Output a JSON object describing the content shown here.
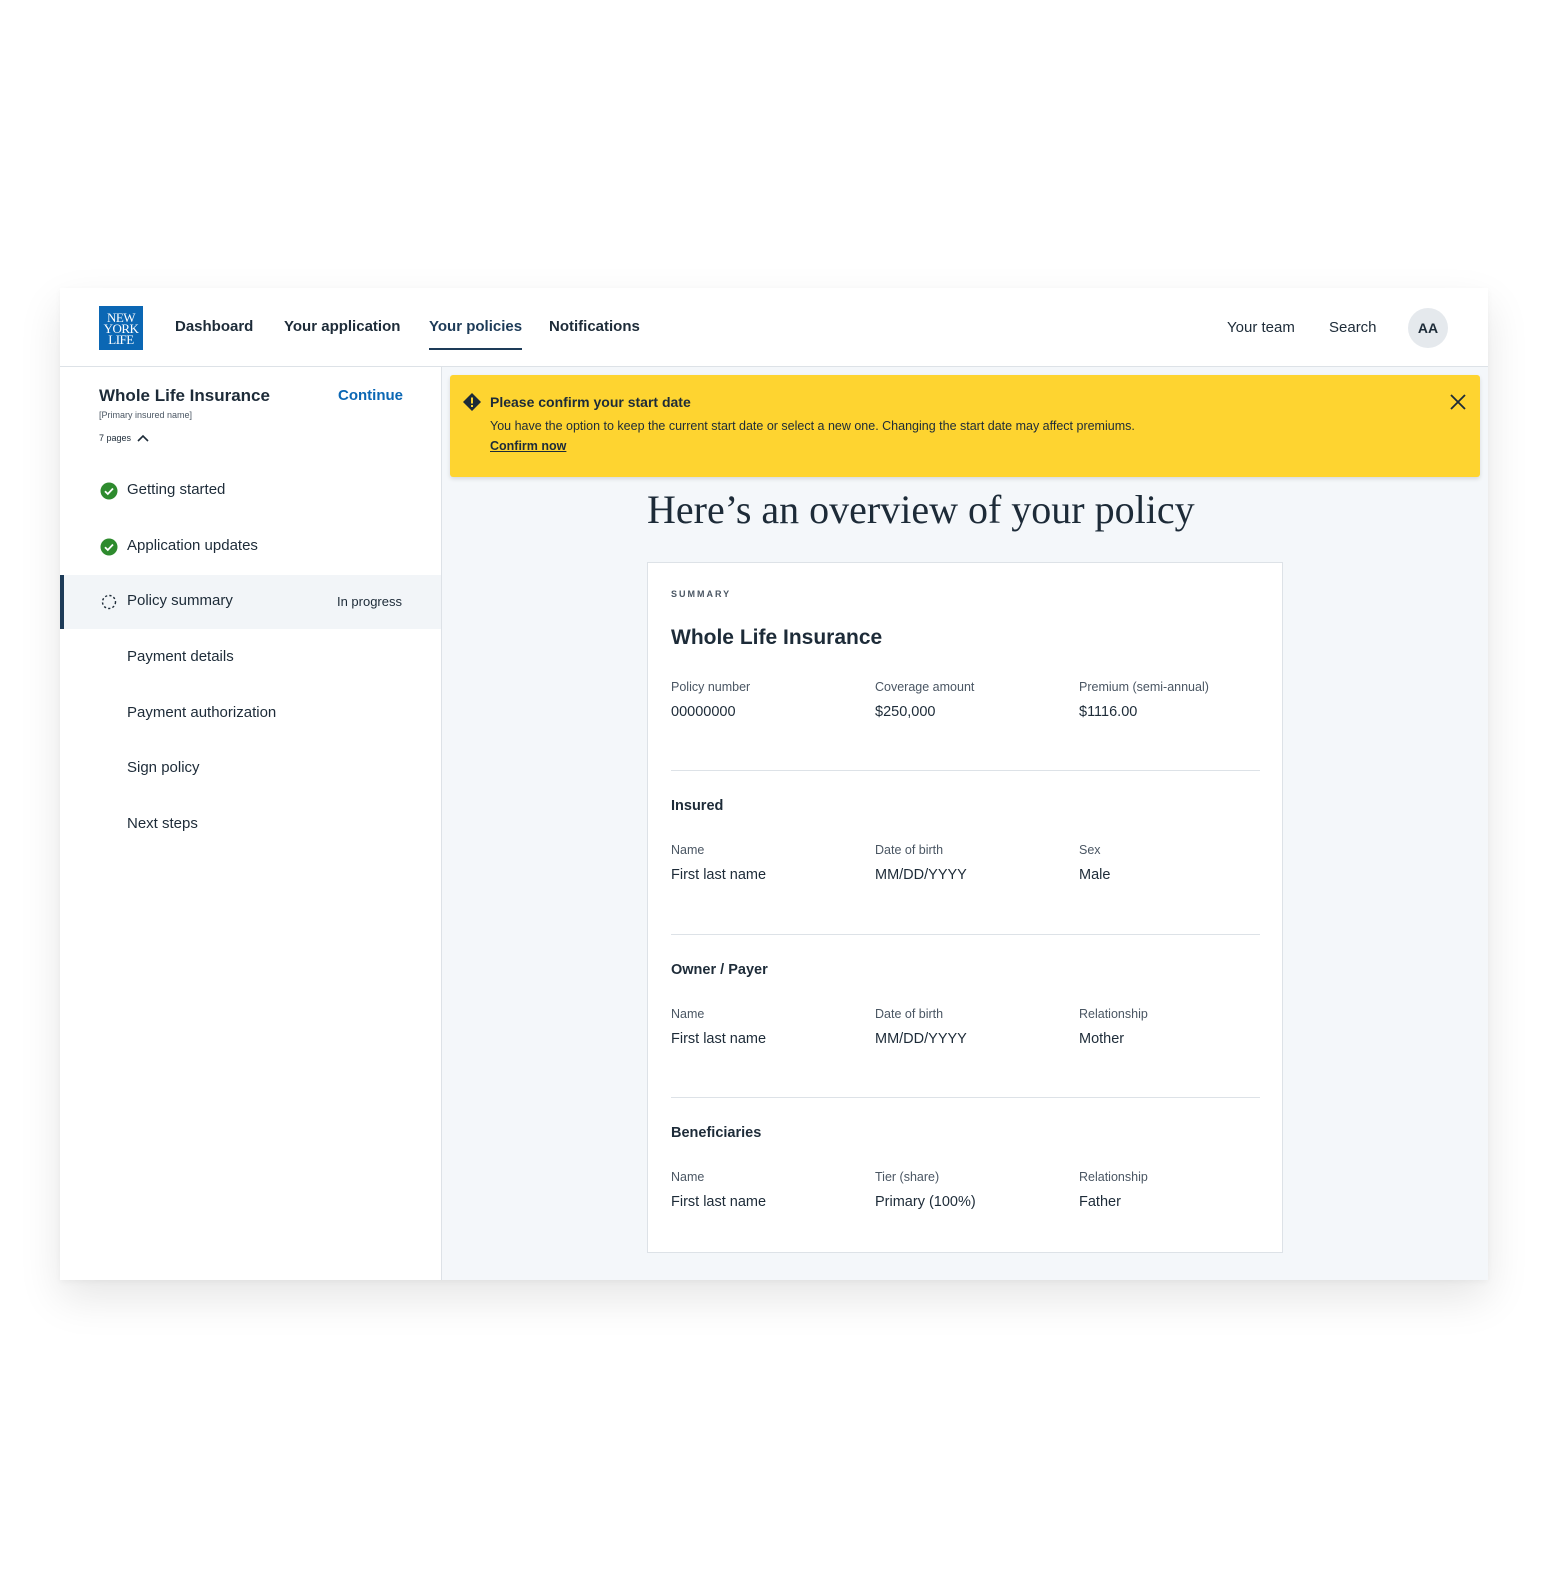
{
  "logo": {
    "line1": "NEW",
    "line2": "YORK",
    "line3": "LIFE"
  },
  "nav": {
    "items": [
      {
        "label": "Dashboard"
      },
      {
        "label": "Your application"
      },
      {
        "label": "Your policies"
      },
      {
        "label": "Notifications"
      }
    ],
    "active": "Your policies",
    "team_label": "Your team",
    "search_label": "Search",
    "avatar_initials": "AA"
  },
  "sidebar": {
    "title": "Whole Life Insurance",
    "continue_label": "Continue",
    "subtitle": "[Primary insured name]",
    "pages_label": "7 pages",
    "steps": [
      {
        "label": "Getting started",
        "state": "complete",
        "status": ""
      },
      {
        "label": "Application updates",
        "state": "complete",
        "status": ""
      },
      {
        "label": "Policy summary",
        "state": "in-progress",
        "status": "In progress"
      },
      {
        "label": "Payment details",
        "state": "not-started",
        "status": ""
      },
      {
        "label": "Payment authorization",
        "state": "not-started",
        "status": ""
      },
      {
        "label": "Sign policy",
        "state": "not-started",
        "status": ""
      },
      {
        "label": "Next steps",
        "state": "not-started",
        "status": ""
      }
    ]
  },
  "alert": {
    "title": "Please confirm your start date",
    "body": "You have the option to keep the current start date or select a new one. Changing the start date may affect premiums.",
    "link_label": "Confirm now"
  },
  "main": {
    "title": "Here’s an overview of your policy",
    "card": {
      "eyebrow": "SUMMARY",
      "title": "Whole Life Insurance",
      "summary": [
        {
          "label": "Policy number",
          "value": "00000000"
        },
        {
          "label": "Coverage amount",
          "value": "$250,000"
        },
        {
          "label": "Premium (semi-annual)",
          "value": "$1116.00"
        }
      ],
      "sections": [
        {
          "title": "Insured",
          "fields": [
            {
              "label": "Name",
              "value": "First last name"
            },
            {
              "label": "Date of birth",
              "value": "MM/DD/YYYY"
            },
            {
              "label": "Sex",
              "value": "Male"
            }
          ]
        },
        {
          "title": "Owner / Payer",
          "fields": [
            {
              "label": "Name",
              "value": "First last name"
            },
            {
              "label": "Date of birth",
              "value": "MM/DD/YYYY"
            },
            {
              "label": "Relationship",
              "value": "Mother"
            }
          ]
        },
        {
          "title": "Beneficiaries",
          "fields": [
            {
              "label": "Name",
              "value": "First last name"
            },
            {
              "label": "Tier (share)",
              "value": "Primary (100%)"
            },
            {
              "label": "Relationship",
              "value": "Father"
            }
          ]
        }
      ]
    }
  },
  "colors": {
    "brand_blue": "#0b67b4",
    "navy": "#1d3b58",
    "alert_yellow": "#fed430",
    "complete_green": "#2e8b2e"
  }
}
